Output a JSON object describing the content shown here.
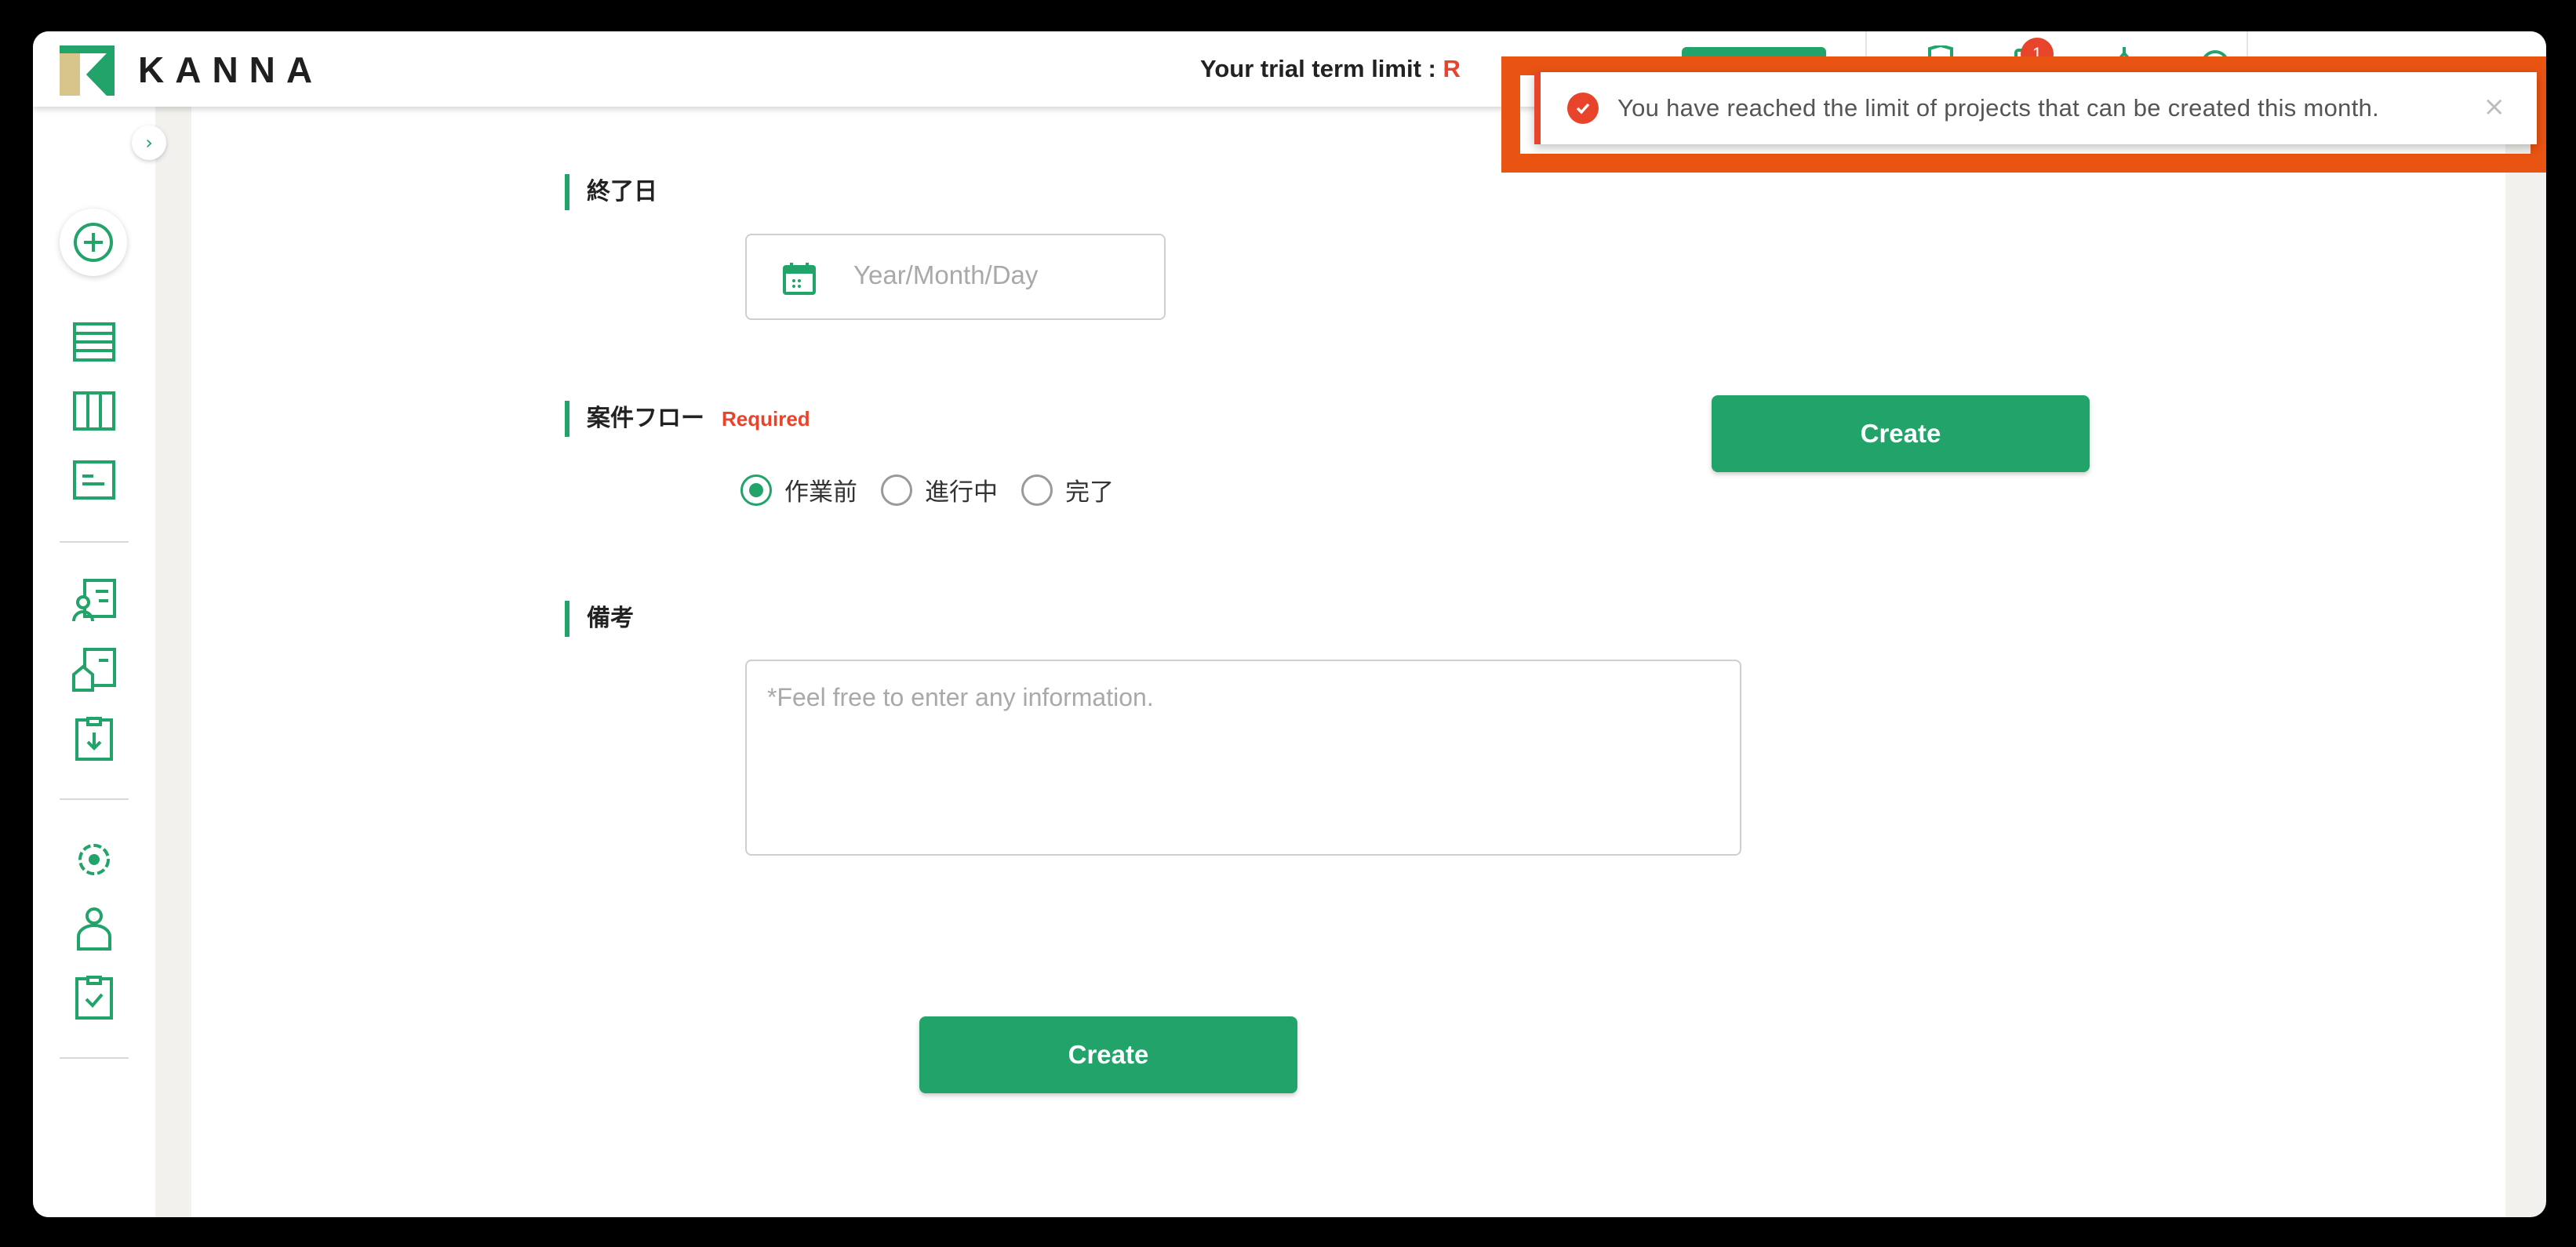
{
  "header": {
    "logo_text": "KANNA",
    "trial_label": "Your trial term limit : ",
    "trial_value": "R",
    "notification_count": "1"
  },
  "sidebar": {
    "toggle_icon": "chevron-right-icon",
    "items": [
      {
        "icon": "plus-circle-icon"
      },
      {
        "icon": "list-icon"
      },
      {
        "icon": "columns-icon"
      },
      {
        "icon": "board-icon"
      },
      {
        "icon": "client-card-icon"
      },
      {
        "icon": "building-card-icon"
      },
      {
        "icon": "download-clipboard-icon"
      },
      {
        "icon": "gear-icon"
      },
      {
        "icon": "user-icon"
      },
      {
        "icon": "check-clipboard-icon"
      }
    ]
  },
  "form": {
    "end_date_label": "終了日",
    "end_date_placeholder": "Year/Month/Day",
    "flow_label": "案件フロー",
    "required_label": "Required",
    "flow_options": [
      "作業前",
      "進行中",
      "完了"
    ],
    "flow_selected": "作業前",
    "notes_label": "備考",
    "notes_placeholder": "*Feel free to enter any information.",
    "create_top_label": "Create",
    "create_bottom_label": "Create"
  },
  "toast": {
    "message": "You have reached the limit of projects that can be created this month.",
    "close_symbol": "×"
  },
  "colors": {
    "brand_green": "#21a36a",
    "alert_red": "#e8442b",
    "highlight_orange": "#ea5413"
  }
}
